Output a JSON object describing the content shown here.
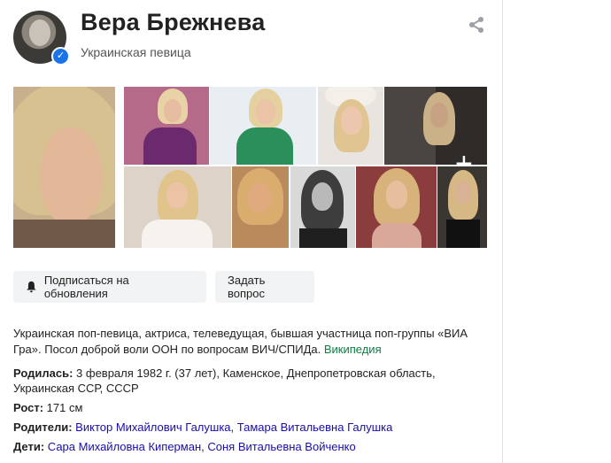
{
  "header": {
    "name": "Вера Брежнева",
    "subtitle": "Украинская певица"
  },
  "buttons": {
    "subscribe_label": "Подписаться на обновления",
    "ask_label": "Задать вопрос"
  },
  "description": {
    "text": "Украинская поп-певица, актриса, телеведущая, бывшая участница поп-группы «ВИА Гра». Посол доброй воли ООН по вопросам ВИЧ/СПИДа.",
    "source_link": "Википедия"
  },
  "facts": {
    "born_label": "Родилась:",
    "born_value": "3 февраля 1982 г. (37 лет), Каменское, Днепропетровская область, Украинская ССР, СССР",
    "height_label": "Рост:",
    "height_value": "171 см",
    "parents_label": "Родители:",
    "parent_1": "Виктор Михайлович Галушка",
    "parent_sep": ", ",
    "parent_2": "Тамара Витальевна Галушка",
    "children_label": "Дети:",
    "child_1": "Сара Михайловна Киперман",
    "child_sep": ", ",
    "child_2": "Соня Витальевна Войченко"
  },
  "photos": {
    "more_symbol": "+"
  },
  "icons": {
    "share": "share-icon",
    "verified": "verified-icon",
    "bell": "bell-icon"
  },
  "colors": {
    "link": "#1a0dab",
    "wiki": "#0b8043",
    "verified": "#1a73e8",
    "button_bg": "#f1f3f4"
  }
}
